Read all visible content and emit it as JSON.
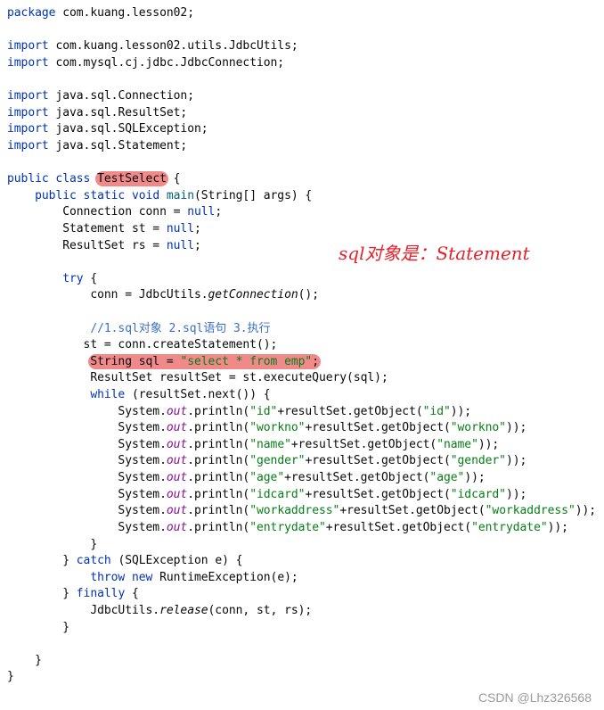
{
  "code": [
    {
      "tokens": [
        [
          "k",
          "package"
        ],
        [
          "n",
          " com.kuang.lesson02;"
        ]
      ]
    },
    {
      "tokens": []
    },
    {
      "tokens": [
        [
          "k",
          "import"
        ],
        [
          "n",
          " com.kuang.lesson02.utils.JdbcUtils;"
        ]
      ]
    },
    {
      "tokens": [
        [
          "k",
          "import"
        ],
        [
          "n",
          " com.mysql.cj.jdbc.JdbcConnection;"
        ]
      ]
    },
    {
      "tokens": []
    },
    {
      "tokens": [
        [
          "k",
          "import"
        ],
        [
          "n",
          " java.sql.Connection;"
        ]
      ]
    },
    {
      "tokens": [
        [
          "k",
          "import"
        ],
        [
          "n",
          " java.sql.ResultSet;"
        ]
      ]
    },
    {
      "tokens": [
        [
          "k",
          "import"
        ],
        [
          "n",
          " java.sql.SQLException;"
        ]
      ]
    },
    {
      "tokens": [
        [
          "k",
          "import"
        ],
        [
          "n",
          " java.sql.Statement;"
        ]
      ]
    },
    {
      "tokens": []
    },
    {
      "tokens": [
        [
          "k",
          "public class "
        ],
        [
          "n hl",
          "TestSelect"
        ],
        [
          "n",
          " {"
        ]
      ]
    },
    {
      "tokens": [
        [
          "n",
          "    "
        ],
        [
          "k",
          "public static void "
        ],
        [
          "f",
          "main"
        ],
        [
          "n",
          "(String[] args) {"
        ]
      ]
    },
    {
      "tokens": [
        [
          "n",
          "        Connection conn = "
        ],
        [
          "k",
          "null"
        ],
        [
          "n",
          ";"
        ]
      ]
    },
    {
      "tokens": [
        [
          "n",
          "        Statement st = "
        ],
        [
          "k",
          "null"
        ],
        [
          "n",
          ";"
        ]
      ]
    },
    {
      "tokens": [
        [
          "n",
          "        ResultSet rs = "
        ],
        [
          "k",
          "null"
        ],
        [
          "n",
          ";"
        ]
      ]
    },
    {
      "tokens": []
    },
    {
      "tokens": [
        [
          "n",
          "        "
        ],
        [
          "k",
          "try"
        ],
        [
          "n",
          " {"
        ]
      ]
    },
    {
      "tokens": [
        [
          "n",
          "            conn = JdbcUtils."
        ],
        [
          "i",
          "getConnection"
        ],
        [
          "n",
          "();"
        ]
      ]
    },
    {
      "tokens": []
    },
    {
      "tokens": [
        [
          "n",
          "            "
        ],
        [
          "c",
          "//1.sql对象 2.sql语句 3.执行"
        ]
      ]
    },
    {
      "tokens": [
        [
          "n",
          "           st = conn.createStatement();"
        ]
      ]
    },
    {
      "lead": "            ",
      "highlight": true,
      "tokens": [
        [
          "n",
          "String sql = "
        ],
        [
          "s",
          "\"select * from emp\""
        ],
        [
          "n",
          ";"
        ]
      ]
    },
    {
      "tokens": [
        [
          "n",
          "            ResultSet resultSet = st.executeQuery(sql);"
        ]
      ]
    },
    {
      "tokens": [
        [
          "n",
          "            "
        ],
        [
          "k",
          "while"
        ],
        [
          "n",
          " (resultSet.next()) {"
        ]
      ]
    },
    {
      "tokens": [
        [
          "n",
          "                System."
        ],
        [
          "o",
          "out"
        ],
        [
          "n",
          ".println("
        ],
        [
          "s",
          "\"id\""
        ],
        [
          "n",
          "+resultSet.getObject("
        ],
        [
          "s",
          "\"id\""
        ],
        [
          "n",
          "));"
        ]
      ]
    },
    {
      "tokens": [
        [
          "n",
          "                System."
        ],
        [
          "o",
          "out"
        ],
        [
          "n",
          ".println("
        ],
        [
          "s",
          "\"workno\""
        ],
        [
          "n",
          "+resultSet.getObject("
        ],
        [
          "s",
          "\"workno\""
        ],
        [
          "n",
          "));"
        ]
      ]
    },
    {
      "tokens": [
        [
          "n",
          "                System."
        ],
        [
          "o",
          "out"
        ],
        [
          "n",
          ".println("
        ],
        [
          "s",
          "\"name\""
        ],
        [
          "n",
          "+resultSet.getObject("
        ],
        [
          "s",
          "\"name\""
        ],
        [
          "n",
          "));"
        ]
      ]
    },
    {
      "tokens": [
        [
          "n",
          "                System."
        ],
        [
          "o",
          "out"
        ],
        [
          "n",
          ".println("
        ],
        [
          "s",
          "\"gender\""
        ],
        [
          "n",
          "+resultSet.getObject("
        ],
        [
          "s",
          "\"gender\""
        ],
        [
          "n",
          "));"
        ]
      ]
    },
    {
      "tokens": [
        [
          "n",
          "                System."
        ],
        [
          "o",
          "out"
        ],
        [
          "n",
          ".println("
        ],
        [
          "s",
          "\"age\""
        ],
        [
          "n",
          "+resultSet.getObject("
        ],
        [
          "s",
          "\"age\""
        ],
        [
          "n",
          "));"
        ]
      ]
    },
    {
      "tokens": [
        [
          "n",
          "                System."
        ],
        [
          "o",
          "out"
        ],
        [
          "n",
          ".println("
        ],
        [
          "s",
          "\"idcard\""
        ],
        [
          "n",
          "+resultSet.getObject("
        ],
        [
          "s",
          "\"idcard\""
        ],
        [
          "n",
          "));"
        ]
      ]
    },
    {
      "tokens": [
        [
          "n",
          "                System."
        ],
        [
          "o",
          "out"
        ],
        [
          "n",
          ".println("
        ],
        [
          "s",
          "\"workaddress\""
        ],
        [
          "n",
          "+resultSet.getObject("
        ],
        [
          "s",
          "\"workaddress\""
        ],
        [
          "n",
          "));"
        ]
      ]
    },
    {
      "tokens": [
        [
          "n",
          "                System."
        ],
        [
          "o",
          "out"
        ],
        [
          "n",
          ".println("
        ],
        [
          "s",
          "\"entrydate\""
        ],
        [
          "n",
          "+resultSet.getObject("
        ],
        [
          "s",
          "\"entrydate\""
        ],
        [
          "n",
          "));"
        ]
      ]
    },
    {
      "tokens": [
        [
          "n",
          "            }"
        ]
      ]
    },
    {
      "tokens": [
        [
          "n",
          "        } "
        ],
        [
          "k",
          "catch"
        ],
        [
          "n",
          " (SQLException e) {"
        ]
      ]
    },
    {
      "tokens": [
        [
          "n",
          "            "
        ],
        [
          "k",
          "throw new "
        ],
        [
          "n",
          "RuntimeException(e);"
        ]
      ]
    },
    {
      "tokens": [
        [
          "n",
          "        } "
        ],
        [
          "k",
          "finally"
        ],
        [
          "n",
          " {"
        ]
      ]
    },
    {
      "tokens": [
        [
          "n",
          "            JdbcUtils."
        ],
        [
          "i",
          "release"
        ],
        [
          "n",
          "(conn, st, rs);"
        ]
      ]
    },
    {
      "tokens": [
        [
          "n",
          "        }"
        ]
      ]
    },
    {
      "tokens": []
    },
    {
      "tokens": [
        [
          "n",
          "    }"
        ]
      ]
    },
    {
      "tokens": [
        [
          "n",
          "}"
        ]
      ]
    }
  ],
  "annotation": "sql对象是：Statement",
  "watermark": "CSDN @Lhz326568",
  "colors": {
    "keyword": "#0033b3",
    "string": "#067d17",
    "comment": "#3b6fc4",
    "field": "#871094",
    "method": "#00627a",
    "highlight": "#f08a8a",
    "annotation": "#e8202a"
  }
}
